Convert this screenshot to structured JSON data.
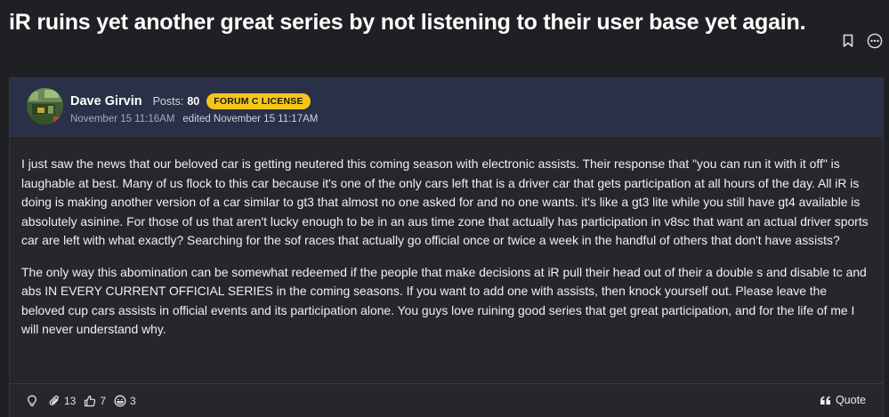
{
  "thread": {
    "title": "iR ruins yet another great series by not listening to their user base yet again."
  },
  "title_actions": {
    "bookmark_icon": "bookmark-icon",
    "more_icon": "more-options-icon"
  },
  "post": {
    "author": {
      "name": "Dave Girvin",
      "posts_label": "Posts:",
      "posts_count": "80",
      "license_badge": "FORUM C LICENSE",
      "badge_color": "#f5c518"
    },
    "posted_at": "November 15 11:16AM",
    "edited_at": "edited November 15 11:17AM",
    "paragraphs": [
      "I just saw the news that our beloved car is getting neutered this coming season with electronic assists. Their response that \"you can run it with it off\" is laughable at best. Many of us flock to this car because it's one of the only cars left that is a driver car that gets participation at all hours of the day. All iR is doing is making another version of a car similar to gt3 that almost no one asked for and no one wants. it's like a gt3 lite while you still have gt4 available is absolutely asinine. For those of us that aren't lucky enough to be in an aus time zone that actually has participation in v8sc that want an actual driver sports car are left with what exactly? Searching for the sof races that actually go official once or twice a week in the handful of others that don't have assists?",
      "The only way this abomination can be somewhat redeemed if the people that make decisions at iR pull their head out of their a double s and disable tc and abs IN EVERY CURRENT OFFICIAL SERIES in the coming seasons. If you want to add one with assists, then knock yourself out. Please leave the beloved cup cars assists in official events and its participation alone. You guys love ruining good series that get great participation, and for the life of me I will never understand why."
    ],
    "reactions": {
      "insightful_icon": "lightbulb-icon",
      "laugh_icon": "paperclip-icon",
      "laugh_count": "13",
      "like_icon": "thumbs-up-icon",
      "like_count": "7",
      "funny_icon": "grin-icon",
      "funny_count": "3"
    },
    "quote_label": "Quote"
  },
  "colors": {
    "background": "#1f2024",
    "post_header": "#293047",
    "post_body": "#26272b"
  }
}
